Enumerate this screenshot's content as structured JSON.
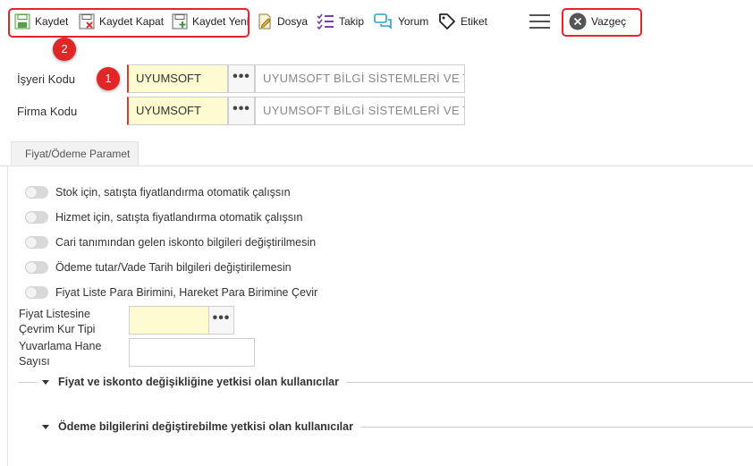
{
  "toolbar": {
    "kaydet": "Kaydet",
    "kaydet_kapat": "Kaydet Kapat",
    "kaydet_yeni": "Kaydet Yeni",
    "dosya": "Dosya",
    "takip": "Takip",
    "yorum": "Yorum",
    "etiket": "Etiket",
    "vazgec": "Vazgeç"
  },
  "badges": {
    "one": "1",
    "two": "2"
  },
  "form": {
    "isyeri": {
      "label": "İşyeri Kodu",
      "code": "UYUMSOFT",
      "desc": "UYUMSOFT BİLGİ SİSTEMLERİ VE TEKN"
    },
    "firma": {
      "label": "Firma Kodu",
      "code": "UYUMSOFT",
      "desc": "UYUMSOFT BİLGİ SİSTEMLERİ VE TEKN"
    },
    "dots": "•••"
  },
  "tabs": [
    "Fiyat/Ödeme Paramet"
  ],
  "toggles": [
    "Stok için, satışta fiyatlandırma otomatik çalışsın",
    "Hizmet için, satışta fiyatlandırma otomatik çalışsın",
    "Cari tanımından gelen iskonto bilgileri değiştirilmesin",
    "Ödeme tutar/Vade Tarih bilgileri değiştirilemesin",
    "Fiyat Liste Para Birimini, Hareket Para Birimine Çevir"
  ],
  "fields": {
    "fiyat_kur_label_1": "Fiyat Listesine",
    "fiyat_kur_label_2": "Çevrim Kur Tipi",
    "yuvarlama_label_1": "Yuvarlama Hane",
    "yuvarlama_label_2": "Sayısı",
    "fiyat_kur_value": "",
    "yuvarlama_value": ""
  },
  "sections": [
    "Fiyat ve iskonto değişikliğine yetkisi olan kullanıcılar",
    "Ödeme bilgilerini değiştirebilme yetkisi olan kullanıcılar"
  ],
  "colors": {
    "highlight": "#e8232b",
    "required_bg": "#fffbd0",
    "badge": "#e02626"
  },
  "icons": [
    "save-icon",
    "save-close-icon",
    "save-new-icon",
    "file-edit-icon",
    "checklist-icon",
    "comment-icon",
    "tag-icon",
    "menu-icon",
    "cancel-icon"
  ]
}
